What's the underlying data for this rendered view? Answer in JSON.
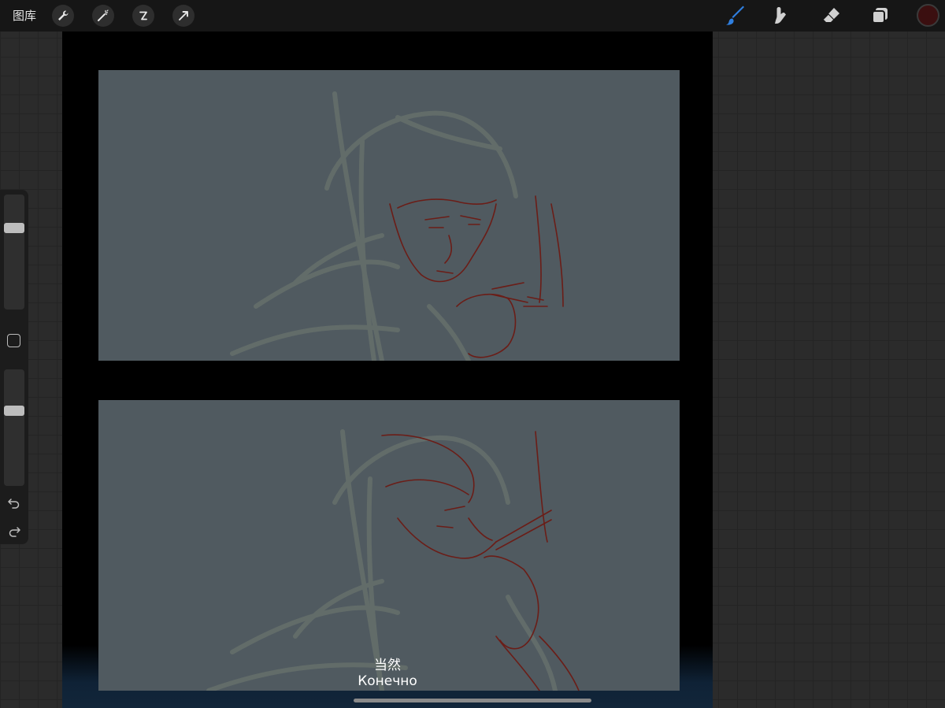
{
  "toolbar": {
    "gallery_label": "图库",
    "left_tools": [
      "wrench-icon",
      "magic-wand-icon",
      "selection-icon",
      "move-arrow-icon"
    ],
    "right_tools": [
      "brush-icon",
      "smudge-icon",
      "eraser-icon",
      "layers-icon"
    ],
    "active_tool": "brush-icon",
    "active_color": "#3b0f10",
    "accent": "#2f7fe0"
  },
  "sidebar": {
    "brush_size": 0.27,
    "opacity": 0.34
  },
  "canvas": {
    "panel_color": "#505a60",
    "sketch_color": "#6b1d17"
  },
  "subtitle": {
    "line_cn": "当然",
    "line_ru": "Конечно"
  }
}
